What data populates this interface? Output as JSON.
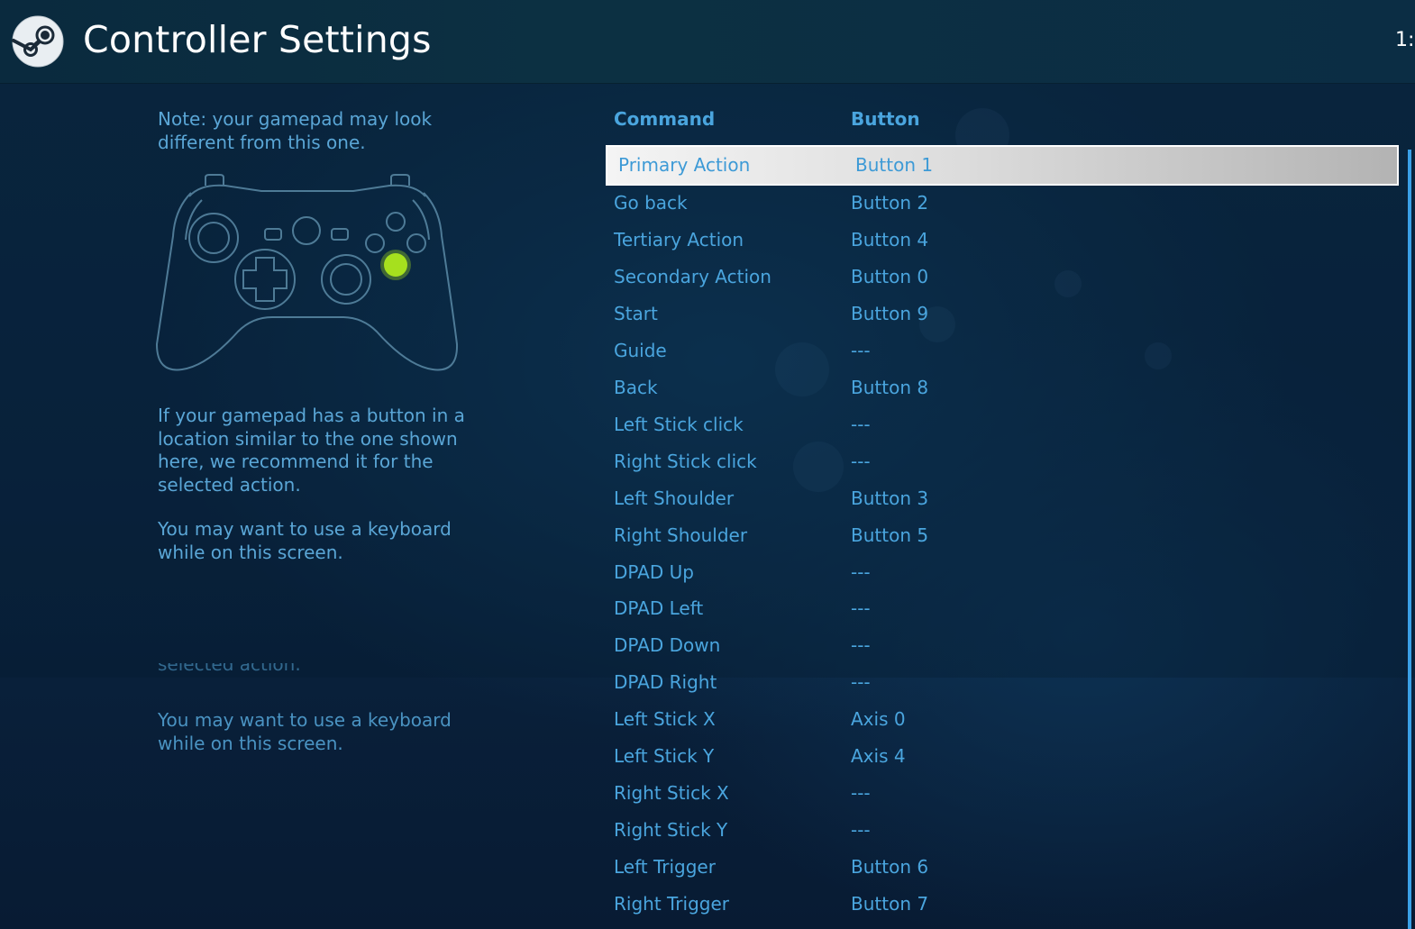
{
  "header": {
    "title": "Controller Settings",
    "clock": "1:"
  },
  "left_panel": {
    "note": "Note: your gamepad may look different from this one.",
    "recommendation": "If your gamepad has a button in a location similar to the one shown here, we recommend it for the selected action.",
    "keyboard_hint": "You may want to use a keyboard while on this screen.",
    "ghost_partial": "selected action.",
    "ghost_keyboard_hint": "You may want to use a keyboard while on this screen.",
    "highlight_color": "#a6e01e"
  },
  "table": {
    "headers": {
      "command": "Command",
      "button": "Button"
    },
    "selected_index": 0,
    "rows": [
      {
        "command": "Primary Action",
        "button": "Button 1"
      },
      {
        "command": "Go back",
        "button": "Button 2"
      },
      {
        "command": "Tertiary Action",
        "button": "Button 4"
      },
      {
        "command": "Secondary Action",
        "button": "Button 0"
      },
      {
        "command": "Start",
        "button": "Button 9"
      },
      {
        "command": "Guide",
        "button": "---"
      },
      {
        "command": "Back",
        "button": "Button 8"
      },
      {
        "command": "Left Stick click",
        "button": "---"
      },
      {
        "command": "Right Stick click",
        "button": "---"
      },
      {
        "command": "Left Shoulder",
        "button": "Button 3"
      },
      {
        "command": "Right Shoulder",
        "button": "Button 5"
      },
      {
        "command": "DPAD Up",
        "button": "---"
      },
      {
        "command": "DPAD Left",
        "button": "---"
      },
      {
        "command": "DPAD Down",
        "button": "---"
      },
      {
        "command": "DPAD Right",
        "button": "---"
      },
      {
        "command": "Left Stick X",
        "button": "Axis 0"
      },
      {
        "command": "Left Stick Y",
        "button": "Axis 4"
      },
      {
        "command": "Right Stick X",
        "button": "---"
      },
      {
        "command": "Right Stick Y",
        "button": "---"
      },
      {
        "command": "Left Trigger",
        "button": "Button 6"
      },
      {
        "command": "Right Trigger",
        "button": "Button 7"
      }
    ]
  },
  "colors": {
    "accent": "#4aa5de",
    "selected_row_bg": "#e6e6e6"
  }
}
